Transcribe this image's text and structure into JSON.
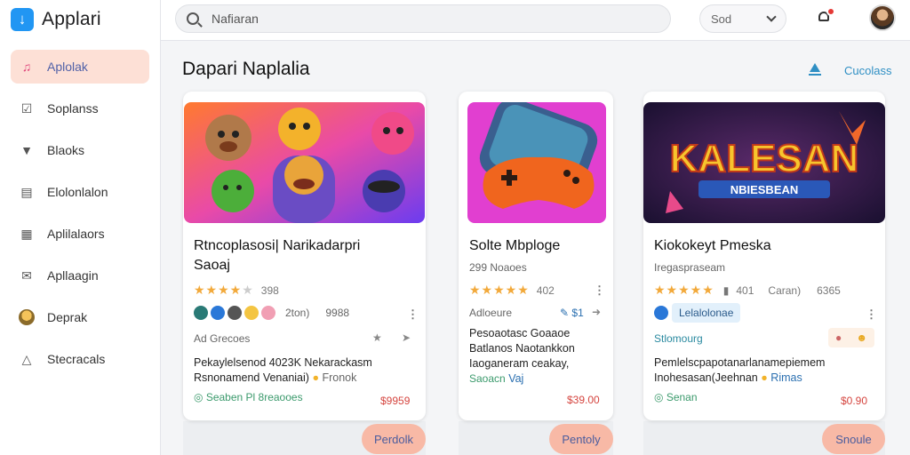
{
  "app": {
    "name": "Applari"
  },
  "sidebar": {
    "items": [
      {
        "label": "Aplolak",
        "icon": "music-note-icon",
        "active": true
      },
      {
        "label": "Soplanss",
        "icon": "checkbox-icon"
      },
      {
        "label": "Blaoks",
        "icon": "shield-icon"
      },
      {
        "label": "Elolonlalon",
        "icon": "calendar-icon"
      },
      {
        "label": "Aplilalaors",
        "icon": "chart-icon"
      },
      {
        "label": "Apllaagin",
        "icon": "mail-icon"
      },
      {
        "label": "Deprak",
        "icon": "avatar-icon"
      },
      {
        "label": "Stecracals",
        "icon": "triangle-icon"
      }
    ]
  },
  "header": {
    "search_placeholder": "Nafiaran",
    "sort_label": "Sod"
  },
  "section": {
    "title": "Dapari Naplalia",
    "link": "Cucolass"
  },
  "cards": [
    {
      "title_line1": "Rtncoplasosi| Narikadarpri",
      "title_line2": "Saoaj",
      "rating_text": "398",
      "meta1": "2ton)",
      "meta2": "9988",
      "meta3": "Ad Grecoes",
      "body_line1": "Pekaylelsenod 4023K Nekarackasm",
      "body_line2": "Rsnonamend Venaniai)",
      "body_line2_suffix": "Fronok",
      "footer_label": "Seaben Pl 8reaooes",
      "price": "$9959",
      "button": "Perdolk"
    },
    {
      "title_line1": "Solte Mbploge",
      "title_line2": "",
      "subtitle": "299 Noaoes",
      "rating_text": "402",
      "meta3": "Adloeure",
      "meta3_right": "$1",
      "body_line1": "Pesoaotasc Goaaoe",
      "body_line2": "Batlanos Naotankkon",
      "body_line3": "Iaoganeram ceakay,",
      "body_line4": "Saoacn",
      "body_line4_suffix": "Vaj",
      "price": "$39.00",
      "button": "Pentoly"
    },
    {
      "title_line1": "Kiokokeyt Pmeska",
      "title_line2": "",
      "subtitle": "Iregaspraseam",
      "rating_text": "401",
      "meta1": "Caran)",
      "meta2": "6365",
      "chip": "Lelalolonae",
      "meta3": "Stlomourg",
      "body_line1": "Pemlelscpapotanarlanamepiemem",
      "body_line2": "Inohesasan(Jeehnan",
      "body_line2_suffix": "Rimas",
      "footer_label": "Senan",
      "price": "$0.90",
      "button": "Snoule",
      "image_title": "KALESAN",
      "image_subtitle": "NBIESBEAN"
    }
  ],
  "colors": {
    "accent": "#2196f3",
    "active_nav_bg": "#fde0d6",
    "button_bg": "#f8b9a6",
    "star": "#f2a93b",
    "price": "#d5453f"
  }
}
